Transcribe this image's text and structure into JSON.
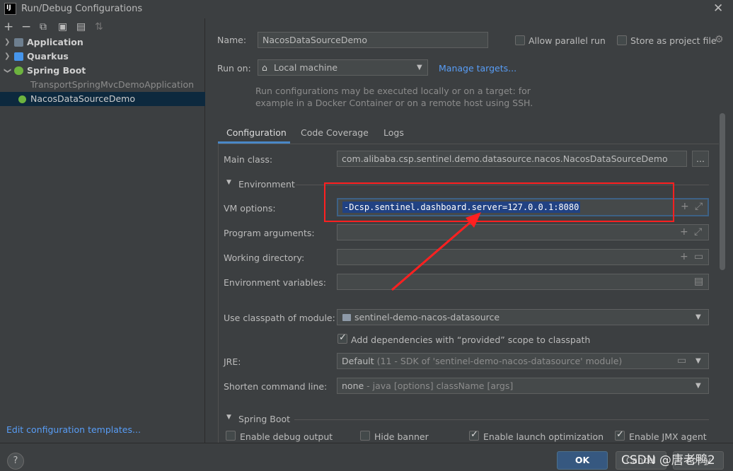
{
  "window": {
    "title": "Run/Debug Configurations",
    "logo": "IJ"
  },
  "toolbar_icons": [
    "add-icon",
    "remove-icon",
    "copy-icon",
    "save-icon",
    "folder-add-icon",
    "sort-icon"
  ],
  "tree": {
    "items": [
      {
        "label": "Application",
        "bold": true,
        "icon": "application-icon"
      },
      {
        "label": "Quarkus",
        "bold": true,
        "icon": "quarkus-icon"
      },
      {
        "label": "Spring Boot",
        "bold": true,
        "icon": "spring-boot-icon"
      },
      {
        "label": "TransportSpringMvcDemoApplication",
        "bold": false
      },
      {
        "label": "NacosDataSourceDemo",
        "bold": false,
        "selected": true
      }
    ],
    "edit_templates": "Edit configuration templates..."
  },
  "header": {
    "name_label": "Name:",
    "name_value": "NacosDataSourceDemo",
    "allow_parallel": "Allow parallel run",
    "store_project": "Store as project file",
    "run_on_label": "Run on:",
    "run_on_value": "Local machine",
    "manage_targets": "Manage targets...",
    "info_line1": "Run configurations may be executed locally or on a target: for",
    "info_line2": "example in a Docker Container or on a remote host using SSH."
  },
  "tabs": [
    {
      "label": "Configuration",
      "active": true
    },
    {
      "label": "Code Coverage",
      "active": false
    },
    {
      "label": "Logs",
      "active": false
    }
  ],
  "config": {
    "main_class_label": "Main class:",
    "main_class_value": "com.alibaba.csp.sentinel.demo.datasource.nacos.NacosDataSourceDemo",
    "browse": "...",
    "environment_section": "Environment",
    "vm_options_label": "VM options:",
    "vm_options_value": "-Dcsp.sentinel.dashboard.server=127.0.0.1:8080",
    "program_args_label": "Program arguments:",
    "working_dir_label": "Working directory:",
    "env_vars_label": "Environment variables:",
    "classpath_label": "Use classpath of module:",
    "classpath_value": "sentinel-demo-nacos-datasource",
    "add_deps": "Add dependencies with “provided” scope to classpath",
    "jre_label": "JRE:",
    "jre_value": "Default",
    "jre_detail": "(11 - SDK of 'sentinel-demo-nacos-datasource' module)",
    "shorten_label": "Shorten command line:",
    "shorten_value": "none",
    "shorten_detail": "- java [options] className [args]",
    "spring_boot_section": "Spring Boot",
    "enable_debug": "Enable debug output",
    "hide_banner": "Hide banner",
    "enable_launch": "Enable launch optimization",
    "enable_jmx": "Enable JMX agent"
  },
  "footer": {
    "help": "?",
    "ok": "OK",
    "cancel": "Cancel",
    "apply": "Apply",
    "watermark": "CSDN @唐老鸭2"
  },
  "colors": {
    "background": "#3c3f41",
    "selection": "#0d293e",
    "link": "#589df6",
    "accent": "#4a88c7",
    "annotation": "#ff2020"
  }
}
